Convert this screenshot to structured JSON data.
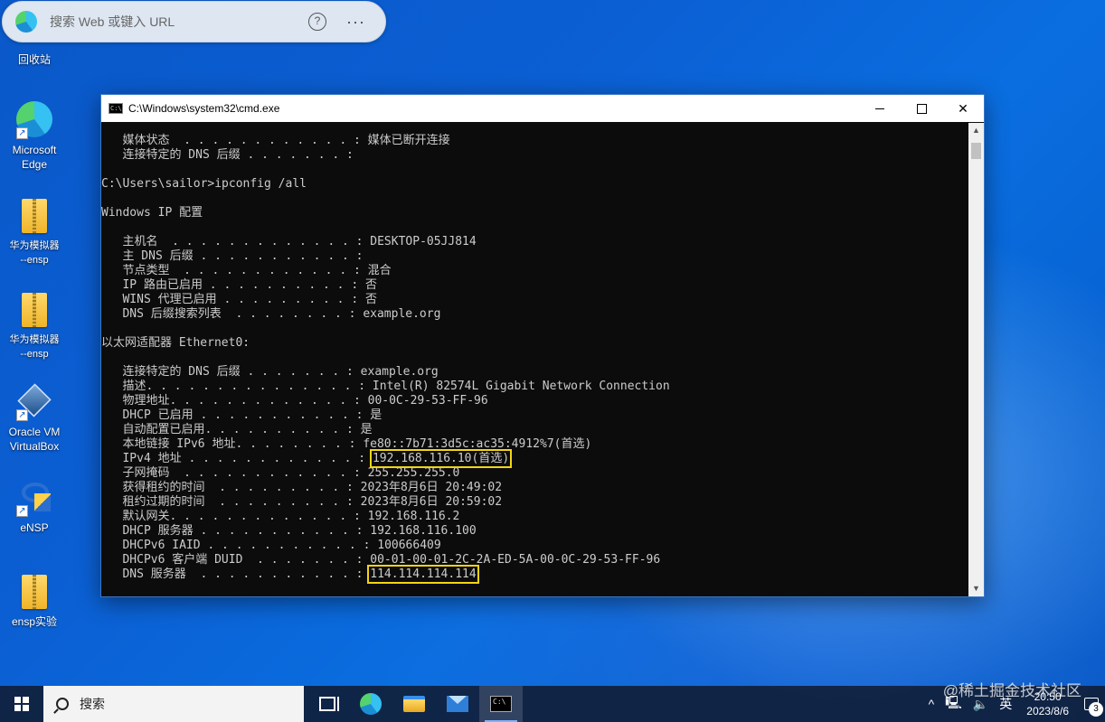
{
  "edge_bar": {
    "placeholder": "搜索 Web 或键入 URL",
    "help": "?",
    "more": "···"
  },
  "desktop_icons": [
    {
      "label": "回收站"
    },
    {
      "label": "Microsoft\nEdge"
    },
    {
      "label": "华为模拟器\n--ensp"
    },
    {
      "label": "华为模拟器\n--ensp"
    },
    {
      "label": "Oracle VM\nVirtualBox"
    },
    {
      "label": "eNSP"
    },
    {
      "label": "ensp实验"
    }
  ],
  "cmd_window": {
    "title": "C:\\Windows\\system32\\cmd.exe",
    "lines": [
      "   媒体状态  . . . . . . . . . . . . : 媒体已断开连接",
      "   连接特定的 DNS 后缀 . . . . . . . :",
      "",
      "C:\\Users\\sailor>ipconfig /all",
      "",
      "Windows IP 配置",
      "",
      "   主机名  . . . . . . . . . . . . . : DESKTOP-05JJ814",
      "   主 DNS 后缀 . . . . . . . . . . . :",
      "   节点类型  . . . . . . . . . . . . : 混合",
      "   IP 路由已启用 . . . . . . . . . . : 否",
      "   WINS 代理已启用 . . . . . . . . . : 否",
      "   DNS 后缀搜索列表  . . . . . . . . : example.org",
      "",
      "以太网适配器 Ethernet0:",
      "",
      "   连接特定的 DNS 后缀 . . . . . . . : example.org",
      "   描述. . . . . . . . . . . . . . . : Intel(R) 82574L Gigabit Network Connection",
      "   物理地址. . . . . . . . . . . . . : 00-0C-29-53-FF-96",
      "   DHCP 已启用 . . . . . . . . . . . : 是",
      "   自动配置已启用. . . . . . . . . . : 是",
      "   本地链接 IPv6 地址. . . . . . . . : fe80::7b71:3d5c:ac35:4912%7(首选)",
      "   IPv4 地址 . . . . . . . . . . . . : ",
      "   子网掩码  . . . . . . . . . . . . : 255.255.255.0",
      "   获得租约的时间  . . . . . . . . . : 2023年8月6日 20:49:02",
      "   租约过期的时间  . . . . . . . . . : 2023年8月6日 20:59:02",
      "   默认网关. . . . . . . . . . . . . : 192.168.116.2",
      "   DHCP 服务器 . . . . . . . . . . . : 192.168.116.100",
      "   DHCPv6 IAID . . . . . . . . . . . : 100666409",
      "   DHCPv6 客户端 DUID  . . . . . . . : 00-01-00-01-2C-2A-ED-5A-00-0C-29-53-FF-96",
      "   DNS 服务器  . . . . . . . . . . . : "
    ],
    "ipv4_value": "192.168.116.10(首选)",
    "dns_value": "114.114.114.114"
  },
  "taskbar": {
    "search_label": "搜索",
    "ime": "英",
    "time": "20:50",
    "date": "2023/8/6",
    "notification_count": "3",
    "tray_chevron": "^"
  },
  "watermark": "@稀土掘金技术社区",
  "colors": {
    "highlight": "#f2d515",
    "console_text": "#cccccc",
    "console_bg": "#0c0c0c"
  }
}
